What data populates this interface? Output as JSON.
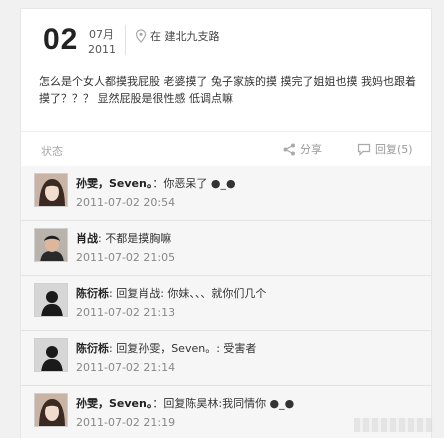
{
  "post": {
    "day": "02",
    "month": "07月",
    "year": "2011",
    "location": "在 建北九支路",
    "text": "怎么是个女人都摸我屁股 老婆摸了 兔子家族的摸 摸完了姐姐也摸 我妈也跟着摸了？？？ 显然屁股是很性感 低调点嘛",
    "status_label": "状态",
    "share_label": "分享",
    "reply_label": "回复(5)"
  },
  "comments": [
    {
      "name": "孙雯，Seven。",
      "text": "：你恶呆了 ●_●",
      "time": "2011-07-02 20:54",
      "avatar": "girl-photo"
    },
    {
      "name": "肖战",
      "text": ": 不都是摸胸嘛",
      "time": "2011-07-02 21:05",
      "avatar": "boy-photo"
    },
    {
      "name": "陈衍栎",
      "text": ": 回复肖战: 你妹、、、就你们几个",
      "time": "2011-07-02 21:13",
      "avatar": "silhouette"
    },
    {
      "name": "陈衍栎",
      "text": ": 回复孙雯，Seven。: 受害者",
      "time": "2011-07-02 21:14",
      "avatar": "silhouette"
    },
    {
      "name": "孙雯，Seven。",
      "text": "：回复陈昊林:我同情你 ●_●",
      "time": "2011-07-02 21:19",
      "avatar": "girl-photo"
    }
  ]
}
